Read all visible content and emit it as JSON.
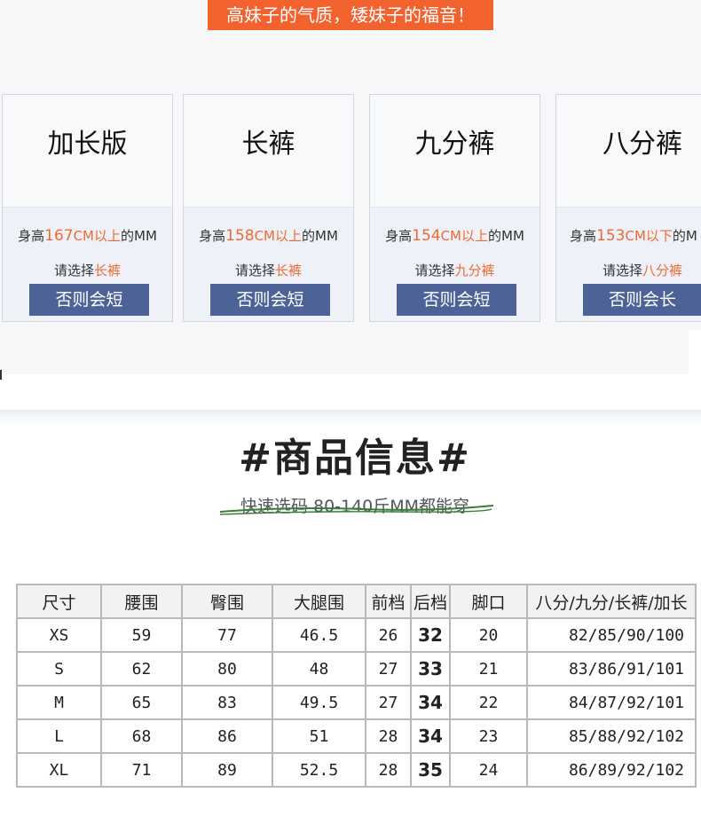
{
  "banner": {
    "text": "高妹子的气质，矮妹子的福音！"
  },
  "cards": [
    {
      "title": "加长版",
      "pre": "身高",
      "height": "167",
      "unit": "CM以上",
      "post": "的MM",
      "choose_pre": "请选择",
      "choose_item": "长裤",
      "button": "否则会短"
    },
    {
      "title": "长裤",
      "pre": "身高",
      "height": "158",
      "unit": "CM以上",
      "post": "的MM",
      "choose_pre": "请选择",
      "choose_item": "长裤",
      "button": "否则会短"
    },
    {
      "title": "九分裤",
      "pre": "身高",
      "height": "154",
      "unit": "CM以上",
      "post": "的MM",
      "choose_pre": "请选择",
      "choose_item": "九分裤",
      "button": "否则会短"
    },
    {
      "title": "八分裤",
      "pre": "身高",
      "height": "153",
      "unit": "CM以下",
      "post": "的M",
      "choose_pre": "请选择",
      "choose_item": "八分裤",
      "button": "否则会长"
    }
  ],
  "info": {
    "heading": "#商品信息#",
    "subheading": "快速选码 80-140斤MM都能穿"
  },
  "size_table": {
    "headers": [
      "尺寸",
      "腰围",
      "臀围",
      "大腿围",
      "前档",
      "后档",
      "脚口",
      "八分/九分/长裤/加长"
    ],
    "rows": [
      [
        "XS",
        "59",
        "77",
        "46.5",
        "26",
        "32",
        "20",
        "82/85/90/100"
      ],
      [
        "S",
        "62",
        "80",
        "48",
        "27",
        "33",
        "21",
        "83/86/91/101"
      ],
      [
        "M",
        "65",
        "83",
        "49.5",
        "27",
        "34",
        "22",
        "84/87/92/101"
      ],
      [
        "L",
        "68",
        "86",
        "51",
        "28",
        "34",
        "23",
        "85/88/92/102"
      ],
      [
        "XL",
        "71",
        "89",
        "52.5",
        "28",
        "35",
        "24",
        "86/89/92/102"
      ]
    ]
  },
  "colors": {
    "banner": "#f2622e",
    "accent_text": "#ef6a33",
    "button": "#4d6398",
    "strike_line": "#3a7d3a"
  }
}
